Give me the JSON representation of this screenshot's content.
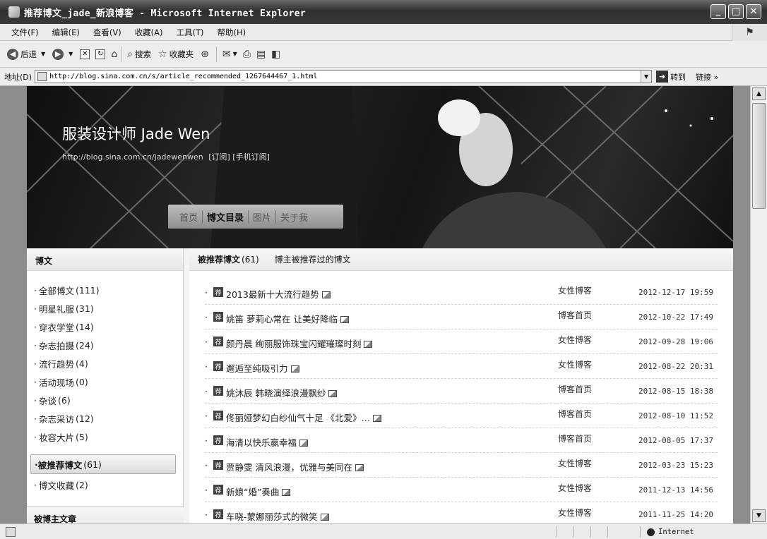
{
  "window": {
    "title": "推荐博文_jade_新浪博客 - Microsoft Internet Explorer"
  },
  "menu": [
    "文件(F)",
    "编辑(E)",
    "查看(V)",
    "收藏(A)",
    "工具(T)",
    "帮助(H)"
  ],
  "toolbar": {
    "back": "后退",
    "search": "搜索",
    "favorites": "收藏夹"
  },
  "address": {
    "label": "地址(D)",
    "url": "http://blog.sina.com.cn/s/article_recommended_1267644467_1.html",
    "go": "转到",
    "links": "链接"
  },
  "banner": {
    "title": "服装设计师 Jade Wen",
    "url": "http://blog.sina.com.cn/jadewenwen",
    "subscribe": "[订阅]",
    "mobile_subscribe": "[手机订阅]",
    "nav": [
      "首页",
      "博文目录",
      "图片",
      "关于我"
    ]
  },
  "sidebar": {
    "heading": "博文",
    "categories": [
      {
        "label": "全部博文",
        "count": "(111)"
      },
      {
        "label": "明星礼服",
        "count": "(31)"
      },
      {
        "label": "穿衣学堂",
        "count": "(14)"
      },
      {
        "label": "杂志拍摄",
        "count": "(24)"
      },
      {
        "label": "流行趋势",
        "count": "(4)"
      },
      {
        "label": "活动现场",
        "count": "(0)"
      },
      {
        "label": "杂谈",
        "count": "(6)"
      },
      {
        "label": "杂志采访",
        "count": "(12)"
      },
      {
        "label": "妆容大片",
        "count": "(5)"
      }
    ],
    "selected": {
      "label": "被推荐博文",
      "count": "(61)"
    },
    "after": {
      "label": "博文收藏",
      "count": "(2)"
    },
    "next_box": "被博主文章"
  },
  "main": {
    "title": "被推荐博文",
    "count": "(61)",
    "desc": "博主被推荐过的博文",
    "tag": "荐",
    "posts": [
      {
        "title": "2013最新十大流行趋势",
        "source": "女性博客",
        "date": "2012-12-17 19:59"
      },
      {
        "title": "姚笛 萝莉心常在 让美好降临",
        "source": "博客首页",
        "date": "2012-10-22 17:49"
      },
      {
        "title": "颜丹晨 绚丽服饰珠宝闪耀璀璨时刻",
        "source": "女性博客",
        "date": "2012-09-28 19:06"
      },
      {
        "title": "邂逅至纯吸引力",
        "source": "女性博客",
        "date": "2012-08-22 20:31"
      },
      {
        "title": "姚沐辰 韩晓演绎浪漫飘纱",
        "source": "博客首页",
        "date": "2012-08-15 18:38"
      },
      {
        "title": "佟丽娅梦幻白纱仙气十足 《北爱》…",
        "source": "博客首页",
        "date": "2012-08-10 11:52"
      },
      {
        "title": "海清以快乐赢幸福",
        "source": "博客首页",
        "date": "2012-08-05 17:37"
      },
      {
        "title": "贾静雯 清风浪漫，优雅与美同在",
        "source": "女性博客",
        "date": "2012-03-23 15:23"
      },
      {
        "title": "新娘“婚”奏曲",
        "source": "女性博客",
        "date": "2011-12-13 14:56"
      },
      {
        "title": "车晓-蒙娜丽莎式的微笑",
        "source": "女性博客",
        "date": "2011-11-25 14:20"
      }
    ]
  },
  "status": {
    "zone": "Internet"
  }
}
